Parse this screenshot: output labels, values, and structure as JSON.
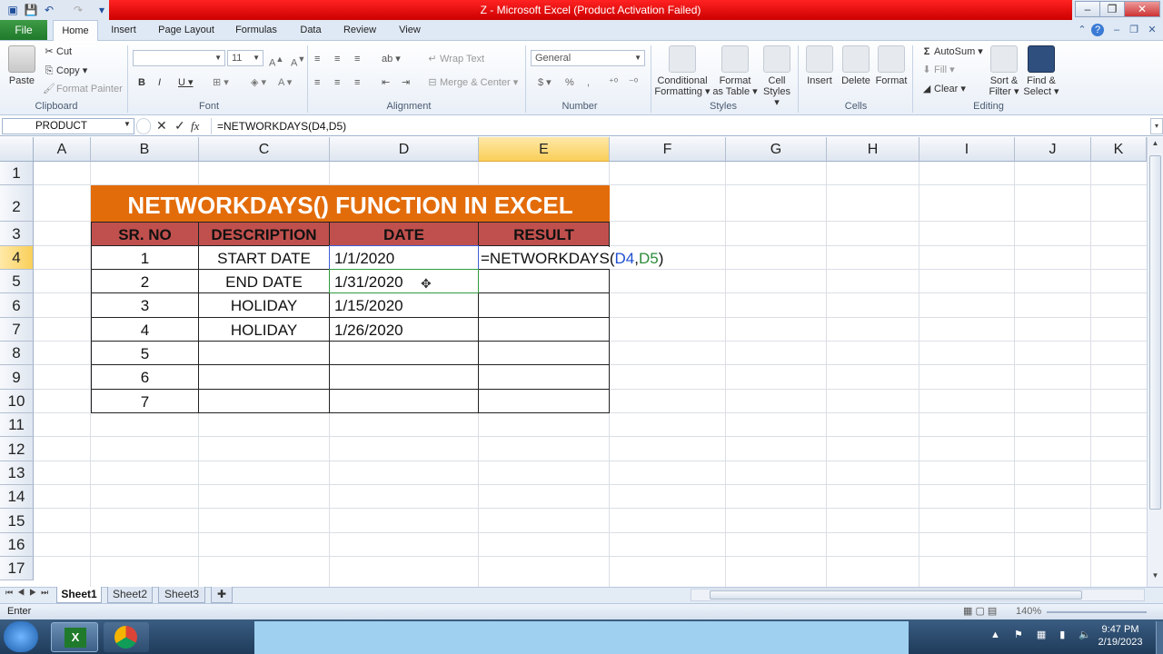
{
  "window": {
    "title": "Z  -  Microsoft Excel (Product Activation Failed)"
  },
  "tabs": [
    "File",
    "Home",
    "Insert",
    "Page Layout",
    "Formulas",
    "Data",
    "Review",
    "View"
  ],
  "ribbon": {
    "clipboard": {
      "paste": "Paste",
      "cut": "Cut",
      "copy": "Copy",
      "format_painter": "Format Painter",
      "label": "Clipboard"
    },
    "font": {
      "font_name": "",
      "font_size": "11",
      "label": "Font"
    },
    "alignment": {
      "wrap_text": "Wrap Text",
      "merge_center": "Merge & Center",
      "label": "Alignment"
    },
    "number": {
      "format": "General",
      "label": "Number"
    },
    "styles": {
      "conditional": [
        "Conditional",
        "Formatting"
      ],
      "format_table": [
        "Format",
        "as Table"
      ],
      "cell_styles": [
        "Cell",
        "Styles"
      ],
      "label": "Styles"
    },
    "cells": {
      "insert": "Insert",
      "delete": "Delete",
      "format": "Format",
      "label": "Cells"
    },
    "editing": {
      "autosum": "AutoSum",
      "fill": "Fill",
      "clear": "Clear",
      "sort": [
        "Sort &",
        "Filter"
      ],
      "find": [
        "Find &",
        "Select"
      ],
      "label": "Editing"
    }
  },
  "formula_bar": {
    "name_box": "PRODUCT",
    "fx": "fx",
    "formula": "=NETWORKDAYS(D4,D5)"
  },
  "columns": [
    "A",
    "B",
    "C",
    "D",
    "E",
    "F",
    "G",
    "H",
    "I",
    "J",
    "K"
  ],
  "rows": [
    "1",
    "2",
    "3",
    "4",
    "5",
    "6",
    "7",
    "8",
    "9",
    "10",
    "11",
    "12",
    "13",
    "14",
    "15",
    "16",
    "17"
  ],
  "table": {
    "banner": "NETWORKDAYS() FUNCTION IN EXCEL",
    "headers": [
      "SR. NO",
      "DESCRIPTION",
      "DATE",
      "RESULT"
    ],
    "rows": [
      [
        "1",
        "START DATE",
        "1/1/2020",
        ""
      ],
      [
        "2",
        "END DATE",
        "1/31/2020",
        ""
      ],
      [
        "3",
        "HOLIDAY",
        "1/15/2020",
        ""
      ],
      [
        "4",
        "HOLIDAY",
        "1/26/2020",
        ""
      ],
      [
        "5",
        "",
        "",
        ""
      ],
      [
        "6",
        "",
        "",
        ""
      ],
      [
        "7",
        "",
        "",
        ""
      ]
    ],
    "editing_formula": {
      "prefix": "=NETWORKDAYS(",
      "ref1": "D4",
      "comma": ",",
      "ref2": "D5",
      "suffix": ")"
    }
  },
  "sheets": [
    "Sheet1",
    "Sheet2",
    "Sheet3"
  ],
  "status": {
    "mode": "Enter",
    "zoom": "140%"
  },
  "taskbar": {
    "time": "9:47 PM",
    "date": "2/19/2023"
  },
  "colors": {
    "banner": "#e36c0a",
    "header": "#c0504d",
    "ref1": "#1f4fd1",
    "ref2": "#2e8b3a",
    "selected_header": "#f9cf59"
  }
}
